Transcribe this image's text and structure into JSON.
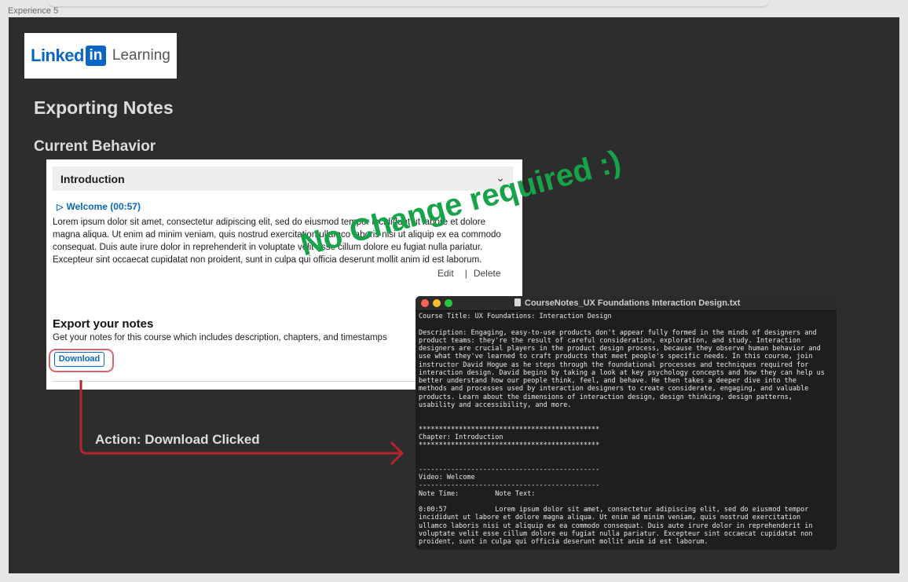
{
  "frame": {
    "label": "Experience 5"
  },
  "logo": {
    "word": "Linked",
    "in": "in",
    "product": "Learning"
  },
  "headings": {
    "title": "Exporting Notes",
    "subtitle": "Current Behavior"
  },
  "panel": {
    "section": "Introduction",
    "video_link": "Welcome (00:57)",
    "note_body": "Lorem ipsum dolor sit amet, consectetur adipiscing elit, sed do eiusmod tempor incididunt ut labore et dolore magna aliqua. Ut enim ad minim veniam, quis nostrud exercitation ullamco laboris nisi ut aliquip ex ea commodo consequat. Duis aute irure dolor in reprehenderit in voluptate velit esse cillum dolore eu fugiat nulla pariatur. Excepteur sint occaecat cupidatat non proident, sunt in culpa qui officia deserunt mollit anim id est laborum.",
    "edit_label": "Edit",
    "delete_label": "Delete",
    "export_title": "Export your notes",
    "export_desc": "Get your notes for this course which includes description, chapters, and timestamps",
    "download_label": "Download"
  },
  "annotation": {
    "action": "Action: Download Clicked",
    "stamp": "No Change required :)",
    "colors": {
      "stamp": "#17a34a",
      "arrow": "#b3262c",
      "highlight": "#cf6a72"
    }
  },
  "terminal": {
    "title": "CourseNotes_UX Foundations Interaction Design.txt",
    "lines": [
      "Course Title: UX Foundations: Interaction Design",
      "",
      "Description: Engaging, easy-to-use products don't appear fully formed in the minds of designers and",
      "product teams: they're the result of careful consideration, exploration, and study. Interaction",
      "designers are crucial players in the product design process, because they observe human behavior and",
      "use what they've learned to craft products that meet people's specific needs. In this course, join",
      "instructor David Hogue as he steps through the foundational processes and techniques required for",
      "interaction design. David begins by taking a look at key psychology concepts and how they can help us",
      "better understand how our people think, feel, and behave. He then takes a deeper dive into the",
      "methods and processes used by interaction designers to create considerate, engaging, and valuable",
      "products. Learn about the dimensions of interaction design, design thinking, design patterns,",
      "usability and accessibility, and more.",
      "",
      "",
      "*********************************************",
      "Chapter: Introduction",
      "*********************************************",
      "",
      "",
      "---------------------------------------------",
      "Video: Welcome",
      "---------------------------------------------",
      "Note Time:         Note Text:",
      "",
      "0:00:57            Lorem ipsum dolor sit amet, consectetur adipiscing elit, sed do eiusmod tempor",
      "incididunt ut labore et dolore magna aliqua. Ut enim ad minim veniam, quis nostrud exercitation",
      "ullamco laboris nisi ut aliquip ex ea commodo consequat. Duis aute irure dolor in reprehenderit in",
      "voluptate velit esse cillum dolore eu fugiat nulla pariatur. Excepteur sint occaecat cupidatat non",
      "proident, sunt in culpa qui officia deserunt mollit anim id est laborum."
    ]
  }
}
